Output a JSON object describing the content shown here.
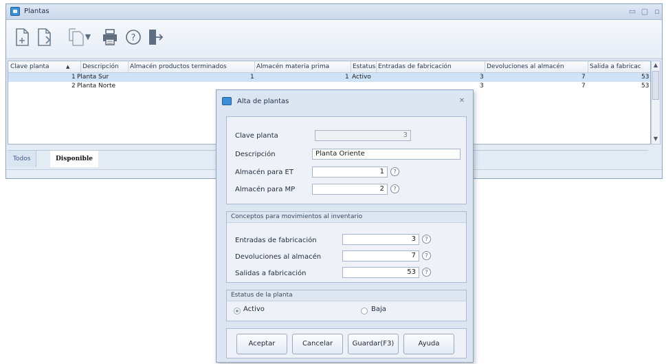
{
  "window": {
    "title": "Plantas",
    "controls": [
      "minimize-icon",
      "maximize-icon",
      "close-icon"
    ]
  },
  "toolbar": {
    "buttons": [
      "new-document-icon",
      "edit-document-icon",
      "copy-icon",
      "print-icon",
      "help-icon",
      "exit-icon"
    ]
  },
  "grid": {
    "columns": [
      "Clave planta",
      "Descripción",
      "Almacén productos terminados",
      "Almacén materia prima",
      "Estatus",
      "Entradas de fabricación",
      "Devoluciones al almacén",
      "Salida a fabricac"
    ],
    "sort_marker": "▲",
    "rows": [
      {
        "clave": "1",
        "descripcion": "Planta Sur",
        "pt": "1",
        "mp": "1",
        "estatus": "Activo",
        "entradas": "3",
        "devoluciones": "7",
        "salida": "53"
      },
      {
        "clave": "2",
        "descripcion": "Planta Norte",
        "pt": "",
        "mp": "",
        "estatus": "",
        "entradas": "3",
        "devoluciones": "7",
        "salida": "53"
      }
    ]
  },
  "tabs": {
    "todos": "Todos",
    "disponible": "Disponible"
  },
  "dialog": {
    "title": "Alta de plantas",
    "fields": {
      "clave_label": "Clave planta",
      "clave_value": "3",
      "descripcion_label": "Descripción",
      "descripcion_value": "Planta Oriente",
      "et_label": "Almacén para ET",
      "et_value": "1",
      "mp_label": "Almacén para MP",
      "mp_value": "2"
    },
    "conceptos": {
      "heading": "Conceptos para movimientos al inventario",
      "entradas_label": "Entradas de fabricación",
      "entradas_value": "3",
      "devoluciones_label": "Devoluciones al almacén",
      "devoluciones_value": "7",
      "salidas_label": "Salidas a fabricación",
      "salidas_value": "53"
    },
    "estatus": {
      "heading": "Estatus de la planta",
      "activo": "Activo",
      "baja": "Baja",
      "selected": "Activo"
    },
    "buttons": {
      "aceptar": "Aceptar",
      "cancelar": "Cancelar",
      "guardar": "Guardar(F3)",
      "ayuda": "Ayuda"
    },
    "help_glyph": "?",
    "close_glyph": "✕"
  }
}
